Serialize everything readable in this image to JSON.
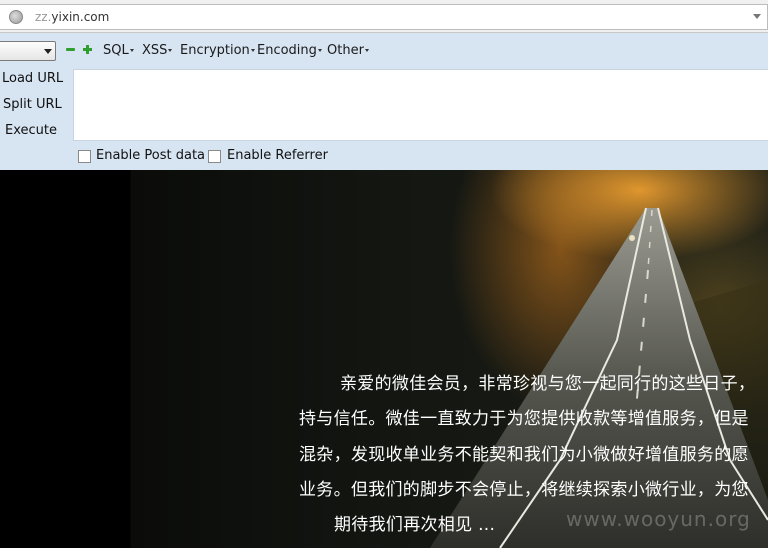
{
  "address_bar": {
    "url_host": "zz.yixin.com",
    "url_prefix": "zz.",
    "url_rest": "yixin.com"
  },
  "hackbar": {
    "menus": [
      {
        "label": "SQL"
      },
      {
        "label": "XSS"
      },
      {
        "label": "Encryption"
      },
      {
        "label": "Encoding"
      },
      {
        "label": "Other"
      }
    ],
    "actions": {
      "load_url": "Load URL",
      "split_url": "Split URL",
      "execute": "Execute"
    },
    "options": {
      "post_data_label": "Enable Post data",
      "post_data_checked": false,
      "referrer_label": "Enable Referrer",
      "referrer_checked": false
    }
  },
  "page": {
    "lines": [
      "亲爱的微佳会员，非常珍视与您一起同行的这些日子，",
      "持与信任。微佳一直致力于为您提供收款等增值服务，但是",
      "混杂，发现收单业务不能契和我们为小微做好增值服务的愿",
      "业务。但我们的脚步不会停止，将继续探索小微行业，为您",
      "期待我们再次相见 ..."
    ],
    "watermark": "www.wooyun.org"
  }
}
